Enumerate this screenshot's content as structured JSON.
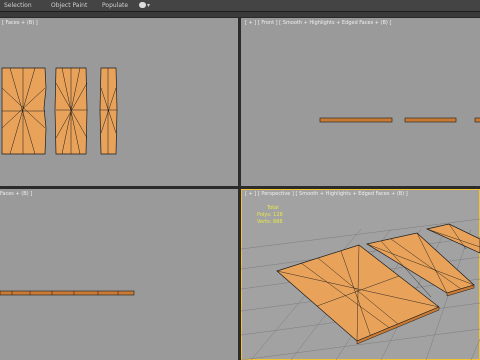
{
  "menubar": {
    "items": [
      "Selection",
      "Object Paint",
      "Populate"
    ],
    "toggle_icon": "circle-toggle-icon",
    "toggle_caret": "▾"
  },
  "viewports": {
    "top_left": {
      "label": "[ Faces + (B) ]"
    },
    "top_right": {
      "label": "[ + ] [ Front ] [ Smooth + Highlights + Edged Faces + (B) ]"
    },
    "bottom_left": {
      "label": "Faces + (B) ]"
    },
    "bottom_right": {
      "label": "[ + ] [ Perspective ] [ Smooth + Highlights + Edged Faces + (B) ]",
      "stats": {
        "title": "Total",
        "polys_label": "Polys:",
        "polys_value": "128",
        "verts_label": "Verts:",
        "verts_value": "888"
      }
    }
  },
  "colors": {
    "wood": "#e9a25a",
    "wood_dark": "#c87a34",
    "edge": "#1c1c1c",
    "viewport_bg": "#9a9a9a",
    "active_border": "#f2c230"
  }
}
